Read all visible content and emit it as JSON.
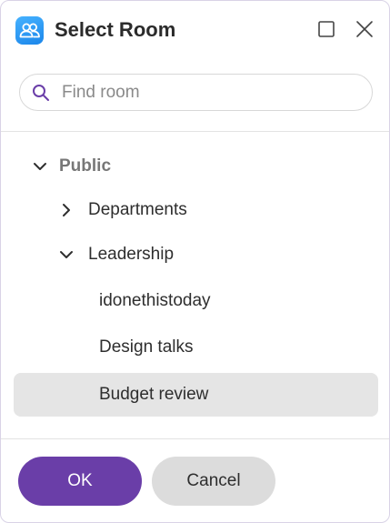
{
  "dialog": {
    "title": "Select Room",
    "app_icon": "people-icon",
    "maximize_icon": "maximize-icon",
    "close_icon": "close-icon"
  },
  "search": {
    "placeholder": "Find room",
    "value": "",
    "icon": "search-icon"
  },
  "tree": {
    "items": [
      {
        "label": "Public",
        "expanded": true,
        "has_children": true,
        "level": 0
      },
      {
        "label": "Departments",
        "expanded": false,
        "has_children": true,
        "level": 1
      },
      {
        "label": "Leadership",
        "expanded": true,
        "has_children": true,
        "level": 1
      },
      {
        "label": "idonethistoday",
        "has_children": false,
        "level": 2
      },
      {
        "label": "Design talks",
        "has_children": false,
        "level": 2
      },
      {
        "label": "Budget review",
        "has_children": false,
        "level": 2,
        "selected": true
      }
    ]
  },
  "footer": {
    "ok_label": "OK",
    "cancel_label": "Cancel"
  },
  "colors": {
    "accent": "#6a3ea8",
    "app_icon_blue": "#2a95f0",
    "selected_row": "#e5e5e5",
    "search_icon": "#6a3ea8"
  }
}
